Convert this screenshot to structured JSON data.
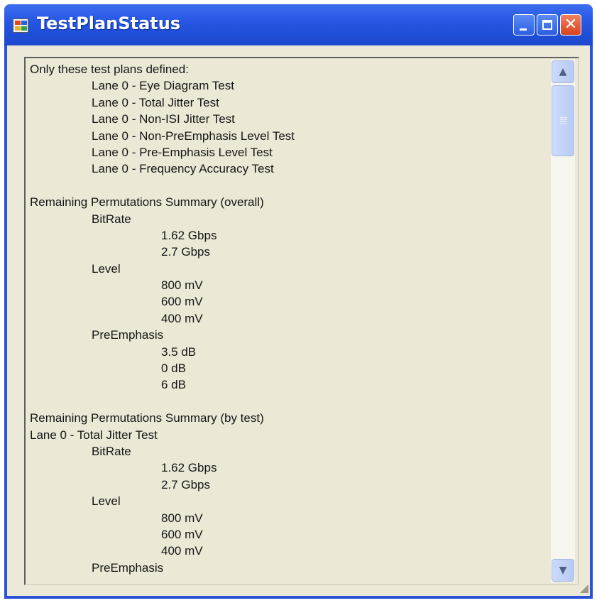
{
  "window": {
    "title": "TestPlanStatus",
    "buttons": {
      "minimize_icon": "minimize-icon",
      "maximize_icon": "maximize-icon",
      "close_icon": "close-icon",
      "close_glyph": "✕"
    }
  },
  "content": {
    "lines": [
      {
        "indent": 0,
        "text": "Only these test plans defined:"
      },
      {
        "indent": 1,
        "text": "Lane 0 - Eye Diagram Test"
      },
      {
        "indent": 1,
        "text": "Lane 0 - Total Jitter Test"
      },
      {
        "indent": 1,
        "text": "Lane 0 - Non-ISI Jitter Test"
      },
      {
        "indent": 1,
        "text": "Lane 0 - Non-PreEmphasis Level Test"
      },
      {
        "indent": 1,
        "text": "Lane 0 - Pre-Emphasis Level Test"
      },
      {
        "indent": 1,
        "text": "Lane 0 - Frequency Accuracy Test"
      },
      {
        "indent": 0,
        "text": ""
      },
      {
        "indent": 0,
        "text": "Remaining Permutations Summary (overall)"
      },
      {
        "indent": 1,
        "text": "BitRate"
      },
      {
        "indent": 2,
        "text": "1.62 Gbps"
      },
      {
        "indent": 2,
        "text": "2.7 Gbps"
      },
      {
        "indent": 1,
        "text": "Level"
      },
      {
        "indent": 2,
        "text": "800 mV"
      },
      {
        "indent": 2,
        "text": "600 mV"
      },
      {
        "indent": 2,
        "text": "400 mV"
      },
      {
        "indent": 1,
        "text": "PreEmphasis"
      },
      {
        "indent": 2,
        "text": "3.5 dB"
      },
      {
        "indent": 2,
        "text": "0 dB"
      },
      {
        "indent": 2,
        "text": "6 dB"
      },
      {
        "indent": 0,
        "text": ""
      },
      {
        "indent": 0,
        "text": "Remaining Permutations Summary (by test)"
      },
      {
        "indent": 0,
        "text": "Lane 0 - Total Jitter Test"
      },
      {
        "indent": 1,
        "text": "BitRate"
      },
      {
        "indent": 2,
        "text": "1.62 Gbps"
      },
      {
        "indent": 2,
        "text": "2.7 Gbps"
      },
      {
        "indent": 1,
        "text": "Level"
      },
      {
        "indent": 2,
        "text": "800 mV"
      },
      {
        "indent": 2,
        "text": "600 mV"
      },
      {
        "indent": 2,
        "text": "400 mV"
      },
      {
        "indent": 1,
        "text": "PreEmphasis"
      }
    ]
  },
  "scrollbar": {
    "up_arrow": "▲",
    "down_arrow": "▼",
    "up_icon": "chevron-up-icon",
    "down_icon": "chevron-down-icon"
  },
  "colors": {
    "title_bar": "#2a5ae6",
    "close_button": "#d9431e",
    "client_bg": "#ece9d8"
  }
}
